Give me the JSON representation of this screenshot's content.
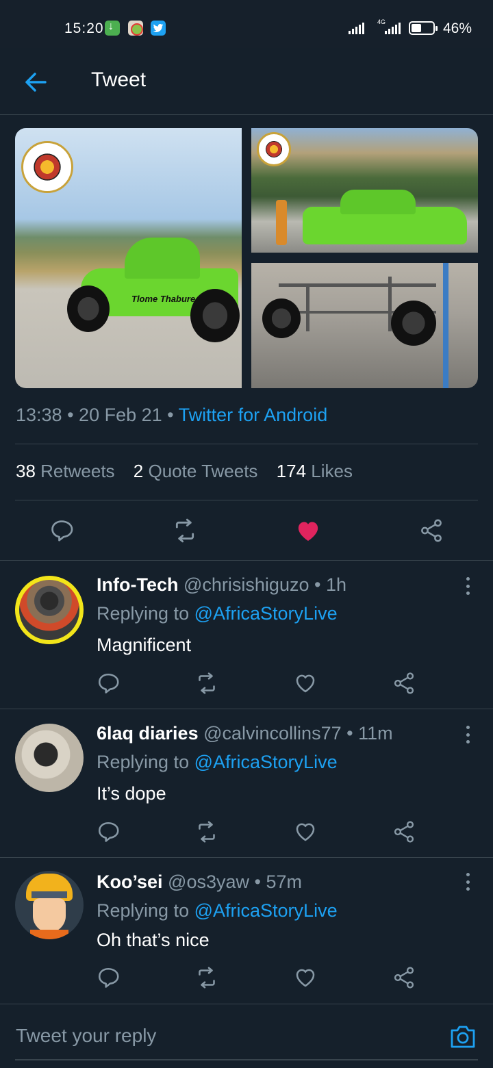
{
  "status_bar": {
    "time": "15:20",
    "network": "4G",
    "battery": "46%",
    "battery_level": 0.46
  },
  "header": {
    "title": "Tweet"
  },
  "tweet": {
    "car_brand": "Tlome Thabure",
    "meta": {
      "time": "13:38",
      "date": "20 Feb 21",
      "source": "Twitter for Android"
    },
    "stats": {
      "retweets_count": "38",
      "retweets_label": "Retweets",
      "quotes_count": "2",
      "quotes_label": "Quote Tweets",
      "likes_count": "174",
      "likes_label": "Likes"
    },
    "liked": true
  },
  "replies": [
    {
      "name": "Info-Tech",
      "handle": "@chrisishiguzo",
      "time": "1h",
      "replying_to_label": "Replying to",
      "replying_to": "@AfricaStoryLive",
      "text": "Magnificent"
    },
    {
      "name": "6laq diaries",
      "handle": "@calvincollins77",
      "time": "11m",
      "replying_to_label": "Replying to",
      "replying_to": "@AfricaStoryLive",
      "text": "It’s dope"
    },
    {
      "name": "Koo’sei",
      "handle": "@os3yaw",
      "time": "57m",
      "replying_to_label": "Replying to",
      "replying_to": "@AfricaStoryLive",
      "text": "Oh that’s nice"
    }
  ],
  "composer": {
    "placeholder": "Tweet your reply"
  },
  "colors": {
    "background": "#15202b",
    "accent": "#1da1f2",
    "like": "#e0245e",
    "muted": "#8899a6",
    "divider": "#38444d"
  }
}
